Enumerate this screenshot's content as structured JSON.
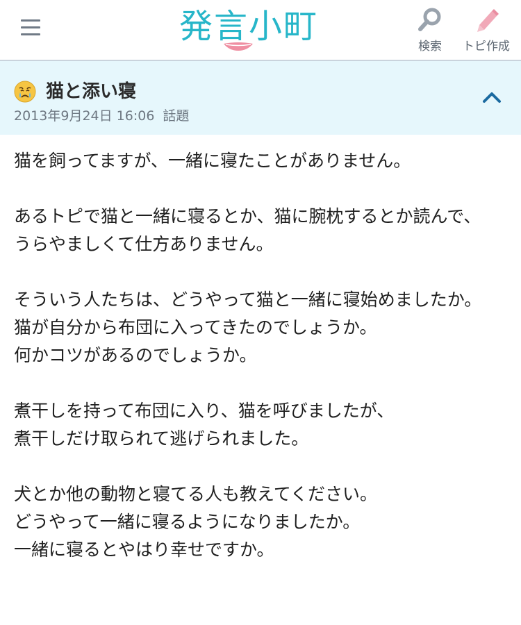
{
  "header": {
    "logo_text": "発言小町",
    "search_label": "検索",
    "create_label": "トピ作成",
    "brand_color": "#27b6c9",
    "accent_color": "#ef8fa2"
  },
  "topic": {
    "emotion_icon": "crying-face-icon",
    "title": "猫と添い寝",
    "date": "2013年9月24日 16:06",
    "category": "話題",
    "background_color": "#e6f7fc"
  },
  "body": {
    "paragraphs": [
      "猫を飼ってますが、一緒に寝たことがありません。",
      "あるトピで猫と一緒に寝るとか、猫に腕枕するとか読んで、\nうらやましくて仕方ありません。",
      "そういう人たちは、どうやって猫と一緒に寝始めましたか。\n猫が自分から布団に入ってきたのでしょうか。\n何かコツがあるのでしょうか。",
      "煮干しを持って布団に入り、猫を呼びましたが、\n煮干しだけ取られて逃げられました。",
      "犬とか他の動物と寝てる人も教えてください。\nどうやって一緒に寝るようになりましたか。\n一緒に寝るとやはり幸せですか。"
    ]
  }
}
